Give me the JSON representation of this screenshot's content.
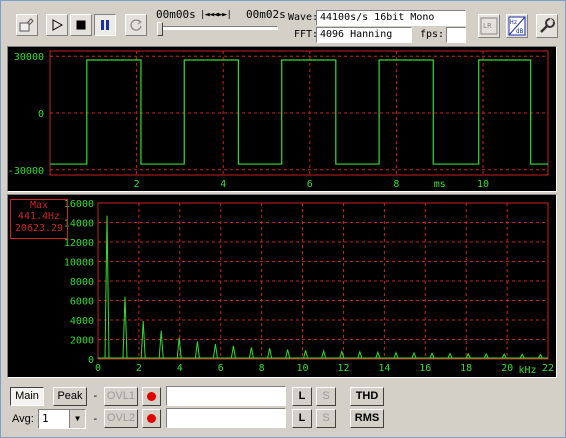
{
  "toolbar": {
    "time_start": "00m00s",
    "time_end": "00m02s",
    "transport_glyphs": "|◄◄◄►►|",
    "wave_label": "Wave:",
    "wave_value": "44100s/s 16bit Mono",
    "fft_label": "FFT:",
    "fft_value": "4096 Hanning",
    "fps_label": "fps:",
    "fps_value": "",
    "lr_label": "LR",
    "hz_label": "Hz",
    "db_label": "dB",
    "playback_progress": 0.0
  },
  "waveform": {
    "y_ticks": [
      "30000",
      "0",
      "-30000"
    ],
    "x_ticks": [
      "2",
      "4",
      "6",
      "8",
      "10"
    ],
    "x_unit": "ms",
    "trace_color": "#33dd33",
    "grid_color": "#cc2222"
  },
  "spectrum": {
    "peak_box": {
      "title": "Max",
      "frequency": "441.4Hz",
      "amplitude": "20623.29"
    },
    "y_ticks": [
      "16000",
      "14000",
      "12000",
      "10000",
      "8000",
      "6000",
      "4000",
      "2000",
      "0"
    ],
    "x_ticks": [
      "0",
      "2",
      "4",
      "6",
      "8",
      "10",
      "12",
      "14",
      "16",
      "18",
      "20",
      "22"
    ],
    "x_unit": "kHz",
    "trace_color": "#33dd33"
  },
  "chart_data": [
    {
      "type": "line",
      "description_source": "waveform",
      "xlabel": "ms",
      "ylabel": "",
      "xlim": [
        0,
        11.5
      ],
      "ylim": [
        -32768,
        32767
      ],
      "series": [
        {
          "x": [
            0,
            0.85,
            0.85,
            2.1,
            2.1,
            3.1,
            3.1,
            4.35,
            4.35,
            5.35,
            5.35,
            6.6,
            6.6,
            7.6,
            7.6,
            8.85,
            8.85,
            9.9,
            9.9,
            11.1,
            11.1,
            11.5
          ],
          "y": [
            -27000,
            -27000,
            28000,
            28000,
            -27000,
            -27000,
            28000,
            28000,
            -27000,
            -27000,
            28000,
            28000,
            -27000,
            -27000,
            28000,
            28000,
            -27000,
            -27000,
            28000,
            28000,
            -27000,
            -27000
          ]
        }
      ],
      "grid": true
    },
    {
      "type": "bar",
      "description_source": "spectrum",
      "xlabel": "kHz",
      "ylabel": "",
      "xlim": [
        0,
        22
      ],
      "ylim": [
        0,
        16000
      ],
      "x": [
        0.44,
        1.32,
        2.21,
        3.09,
        3.97,
        4.86,
        5.74,
        6.62,
        7.5,
        8.39,
        9.27,
        10.15,
        11.03,
        11.92,
        12.8,
        13.68,
        14.57,
        15.45,
        16.33,
        17.21,
        18.1,
        18.98,
        19.86,
        20.74,
        21.63
      ],
      "values": [
        14700,
        6400,
        3900,
        2900,
        2200,
        1800,
        1550,
        1350,
        1200,
        1100,
        980,
        900,
        840,
        780,
        730,
        690,
        650,
        620,
        590,
        560,
        540,
        520,
        500,
        480,
        460
      ],
      "grid": true
    }
  ],
  "bottom": {
    "main_label": "Main",
    "peak_label": "Peak",
    "dash1": "-",
    "ovl1_label": "OVL1",
    "field1_value": "",
    "l_label": "L",
    "s_label": "S",
    "thd_label": "THD",
    "avg_label": "Avg:",
    "avg_value": "1",
    "dash2": "-",
    "ovl2_label": "OVL2",
    "field2_value": "",
    "rms_label": "RMS"
  }
}
